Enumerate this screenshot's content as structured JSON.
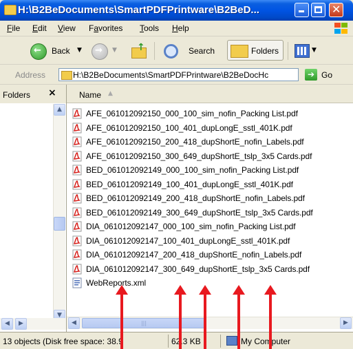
{
  "window": {
    "title": "H:\\B2BeDocuments\\SmartPDFPrintware\\B2BeD..."
  },
  "menu": {
    "items": [
      {
        "pre": "",
        "u": "F",
        "post": "ile"
      },
      {
        "pre": "",
        "u": "E",
        "post": "dit"
      },
      {
        "pre": "",
        "u": "V",
        "post": "iew"
      },
      {
        "pre": "F",
        "u": "a",
        "post": "vorites"
      },
      {
        "pre": "",
        "u": "T",
        "post": "ools"
      },
      {
        "pre": "",
        "u": "H",
        "post": "elp"
      }
    ]
  },
  "toolbar": {
    "back_label": "Back",
    "search_label": "Search",
    "folders_label": "Folders"
  },
  "address": {
    "label": "Address",
    "value": "H:\\B2BeDocuments\\SmartPDFPrintware\\B2BeDocHc",
    "go_label": "Go"
  },
  "folders_pane": {
    "title": "Folders",
    "close": "×"
  },
  "file_list": {
    "column_name": "Name",
    "files": [
      {
        "name": "AFE_061012092150_000_100_sim_nofin_Packing List.pdf",
        "icon": "pdf-icon"
      },
      {
        "name": "AFE_061012092150_100_401_dupLongE_sstl_401K.pdf",
        "icon": "pdf-icon"
      },
      {
        "name": "AFE_061012092150_200_418_dupShortE_nofin_Labels.pdf",
        "icon": "pdf-icon"
      },
      {
        "name": "AFE_061012092150_300_649_dupShortE_tslp_3x5 Cards.pdf",
        "icon": "pdf-icon"
      },
      {
        "name": "BED_061012092149_000_100_sim_nofin_Packing List.pdf",
        "icon": "pdf-icon"
      },
      {
        "name": "BED_061012092149_100_401_dupLongE_sstl_401K.pdf",
        "icon": "pdf-icon"
      },
      {
        "name": "BED_061012092149_200_418_dupShortE_nofin_Labels.pdf",
        "icon": "pdf-icon"
      },
      {
        "name": "BED_061012092149_300_649_dupShortE_tslp_3x5 Cards.pdf",
        "icon": "pdf-icon"
      },
      {
        "name": "DIA_061012092147_000_100_sim_nofin_Packing List.pdf",
        "icon": "pdf-icon"
      },
      {
        "name": "DIA_061012092147_100_401_dupLongE_sstl_401K.pdf",
        "icon": "pdf-icon"
      },
      {
        "name": "DIA_061012092147_200_418_dupShortE_nofin_Labels.pdf",
        "icon": "pdf-icon"
      },
      {
        "name": "DIA_061012092147_300_649_dupShortE_tslp_3x5 Cards.pdf",
        "icon": "pdf-icon"
      },
      {
        "name": "WebReports.xml",
        "icon": "xml-icon"
      }
    ]
  },
  "status": {
    "objects": "13 objects (Disk free space: 38.9",
    "size": "62.3 KB",
    "location": "My Computer"
  },
  "colors": {
    "titlebar": "#0054e3",
    "annotation_arrow": "#e8191f",
    "pdf_icon": "#d6201c"
  }
}
